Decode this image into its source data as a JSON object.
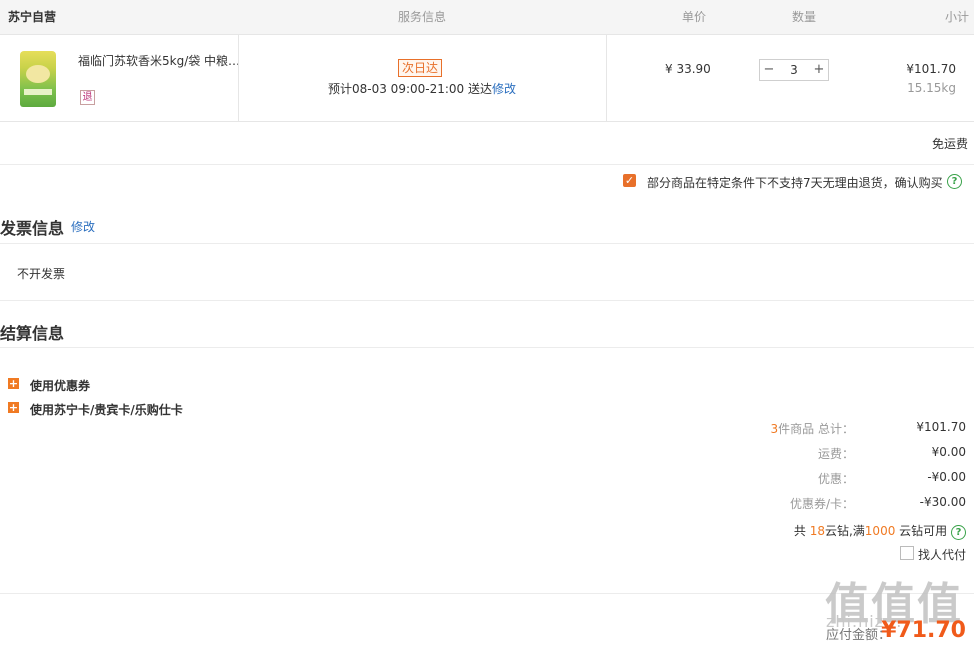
{
  "header": {
    "store": "苏宁自营",
    "service": "服务信息",
    "unit_price": "单价",
    "quantity": "数量",
    "subtotal": "小计"
  },
  "item": {
    "name": "福临门苏软香米5kg/袋 中粮…",
    "return_badge": "退",
    "delivery_badge": "次日达",
    "delivery_text": "预计08-03 09:00-21:00 送达",
    "modify_link": "修改",
    "price": "¥ 33.90",
    "qty": "3",
    "subtotal": "¥101.70",
    "weight": "15.15kg"
  },
  "shipping": {
    "free_label": "免运费"
  },
  "policy": {
    "text": "部分商品在特定条件下不支持7天无理由退货，确认购买",
    "checked": true
  },
  "invoice": {
    "title": "发票信息",
    "modify": "修改",
    "value": "不开发票"
  },
  "settlement": {
    "title": "结算信息",
    "coupon_label": "使用优惠券",
    "card_label": "使用苏宁卡/贵宾卡/乐购仕卡",
    "count_prefix": "3",
    "count_suffix": "件商品 总计：",
    "total_value": "¥101.70",
    "freight_label": "运费：",
    "freight_value": "¥0.00",
    "discount_label": "优惠：",
    "discount_value": "-¥0.00",
    "voucher_label": "优惠券/卡：",
    "voucher_value": "-¥30.00",
    "diamond_a": "共 ",
    "diamond_count": "18",
    "diamond_b": "云钻,满",
    "diamond_threshold": "1000",
    "diamond_c": " 云钻可用",
    "proxy_pay": "找人代付",
    "payable_label": "应付金额：",
    "payable_value": "¥71.70"
  },
  "watermark": {
    "main": "值值值",
    "sub": "zhi.hiz..."
  }
}
